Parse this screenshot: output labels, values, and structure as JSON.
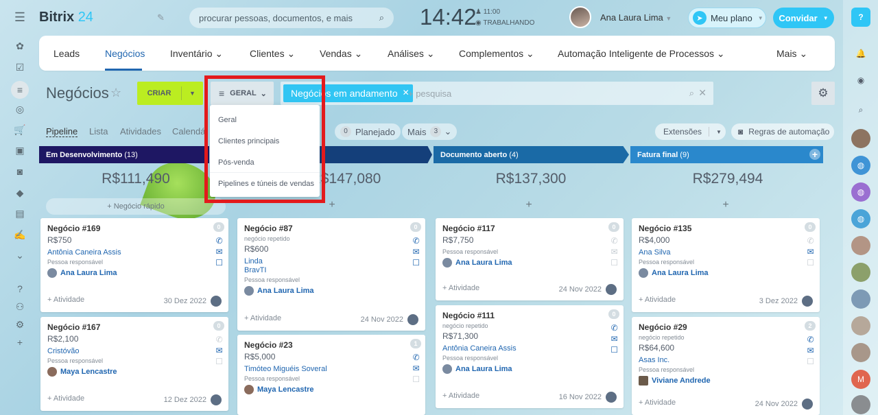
{
  "header": {
    "logo_a": "Bitrix",
    "logo_b": "24",
    "search_placeholder": "procurar pessoas, documentos, e mais",
    "time": "14:42",
    "clock_time": "11:00",
    "clock_status": "TRABALHANDO",
    "user": "Ana Laura Lima",
    "plan": "Meu plano",
    "invite": "Convidar"
  },
  "nav": {
    "items": [
      "Leads",
      "Negócios",
      "Inventário",
      "Clientes",
      "Vendas",
      "Análises",
      "Complementos",
      "Automação Inteligente de Processos",
      "Mais"
    ]
  },
  "toolbar": {
    "title": "Negócios",
    "create": "CRIAR",
    "filter": "GERAL",
    "chip": "Negócios em andamento",
    "search": "+ pesquisa"
  },
  "views": {
    "pipeline": "Pipeline",
    "list": "Lista",
    "activities": "Atividades",
    "calendar": "Calendá",
    "planned_count": "0",
    "planned": "Planejado",
    "more": "Mais",
    "more_count": "3",
    "extensions": "Extensões",
    "rules": "Regras de automação"
  },
  "menu": [
    "Geral",
    "Clientes principais",
    "Pós-venda",
    "Pipelines e túneis de vendas"
  ],
  "columns": [
    {
      "name": "Em Desenvolvimento",
      "count": "(13)",
      "total": "R$111,490",
      "color": "#1e1763",
      "quick": "+ Negócio rápido"
    },
    {
      "name": "",
      "count": "",
      "total": "R$147,080",
      "color": "#143f7a"
    },
    {
      "name": "Documento aberto",
      "count": "(4)",
      "total": "R$137,300",
      "color": "#1a6aa6"
    },
    {
      "name": "Fatura final",
      "count": "(9)",
      "total": "R$279,494",
      "color": "#2a88cc"
    }
  ],
  "cards": [
    {
      "title": "Negócio #169",
      "sub": "",
      "price": "R$750",
      "links": [
        "Antônia Caneira Assis"
      ],
      "resp": "Pessoa responsável",
      "user": "Ana Laura Lima",
      "act": "+ Atividade",
      "date": "30 Dez 2022",
      "badge": "0"
    },
    {
      "title": "Negócio #167",
      "sub": "",
      "price": "R$2,100",
      "links": [
        "Cristóvão"
      ],
      "resp": "Pessoa responsável",
      "user": "Maya Lencastre",
      "act": "+ Atividade",
      "date": "12 Dez 2022",
      "badge": "0"
    },
    {
      "title": "Negócio #87",
      "sub": "negócio repetido",
      "price": "R$600",
      "links": [
        "Linda",
        "BravTI"
      ],
      "resp": "Pessoa responsável",
      "user": "Ana Laura Lima",
      "act": "+ Atividade",
      "date": "24 Nov 2022",
      "badge": "0"
    },
    {
      "title": "Negócio #23",
      "sub": "",
      "price": "R$5,000",
      "links": [
        "Timóteo Miguéis Soveral"
      ],
      "resp": "Pessoa responsável",
      "user": "Maya Lencastre",
      "act": "",
      "date": "",
      "badge": "1"
    },
    {
      "title": "Negócio #117",
      "sub": "",
      "price": "R$7,750",
      "links": [],
      "resp": "Pessoa responsável",
      "user": "Ana Laura Lima",
      "act": "+ Atividade",
      "date": "24 Nov 2022",
      "badge": "0"
    },
    {
      "title": "Negócio #111",
      "sub": "negócio repetido",
      "price": "R$71,300",
      "links": [
        "Antônia Caneira Assis"
      ],
      "resp": "Pessoa responsável",
      "user": "Ana Laura Lima",
      "act": "+ Atividade",
      "date": "16 Nov 2022",
      "badge": "0"
    },
    {
      "title": "Negócio #135",
      "sub": "",
      "price": "R$4,000",
      "links": [
        "Ana Silva"
      ],
      "resp": "Pessoa responsável",
      "user": "Ana Laura Lima",
      "act": "+ Atividade",
      "date": "3 Dez 2022",
      "badge": "0"
    },
    {
      "title": "Negócio #29",
      "sub": "negócio repetido",
      "price": "R$64,600",
      "links": [
        "Asas Inc."
      ],
      "resp": "Pessoa responsável",
      "user": "Viviane Andrede",
      "act": "+ Atividade",
      "date": "24 Nov 2022",
      "badge": "2"
    }
  ]
}
